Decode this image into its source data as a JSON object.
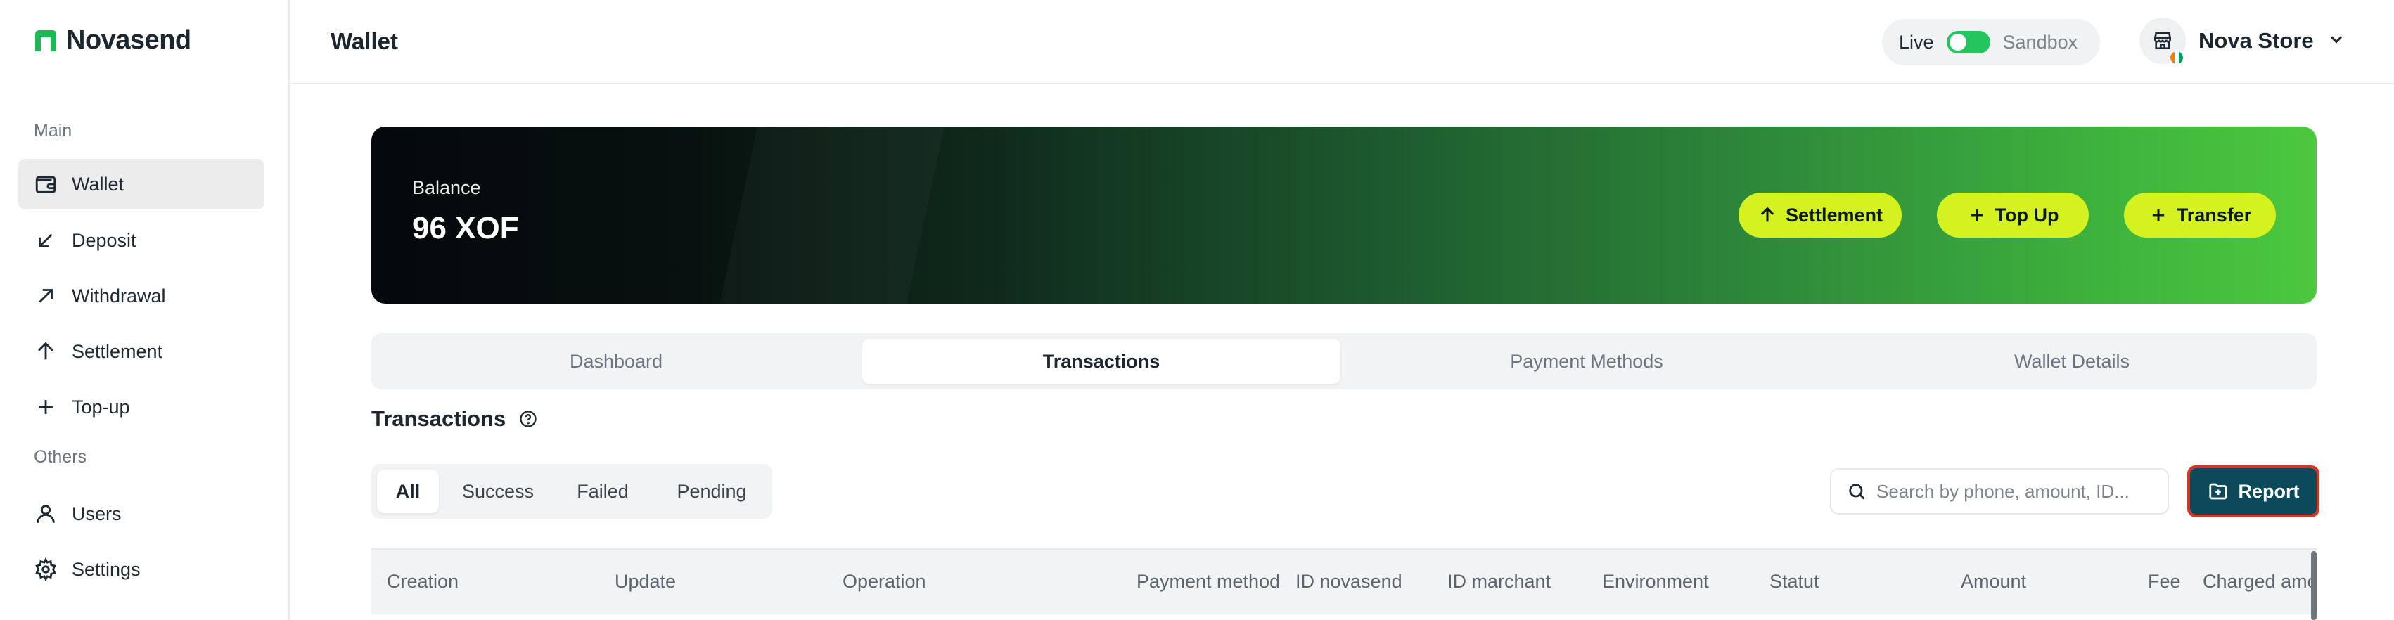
{
  "brand": {
    "name": "Novasend",
    "accent": "#1db954"
  },
  "sidebar": {
    "sections": [
      {
        "label": "Main"
      },
      {
        "label": "Others"
      }
    ],
    "items": [
      {
        "label": "Wallet",
        "icon": "wallet-icon",
        "active": true
      },
      {
        "label": "Deposit",
        "icon": "arrow-down-left-icon"
      },
      {
        "label": "Withdrawal",
        "icon": "arrow-up-right-icon"
      },
      {
        "label": "Settlement",
        "icon": "arrow-up-icon"
      },
      {
        "label": "Top-up",
        "icon": "plus-icon"
      },
      {
        "label": "Users",
        "icon": "user-icon"
      },
      {
        "label": "Settings",
        "icon": "gear-icon"
      }
    ]
  },
  "header": {
    "title": "Wallet",
    "env": {
      "live": "Live",
      "sandbox": "Sandbox",
      "live_enabled": true
    },
    "store": {
      "name": "Nova Store",
      "icon": "store-icon"
    }
  },
  "balance": {
    "label": "Balance",
    "value": "96 XOF",
    "actions": [
      {
        "label": "Settlement",
        "icon": "arrow-up-icon"
      },
      {
        "label": "Top Up",
        "icon": "plus-icon"
      },
      {
        "label": "Transfer",
        "icon": "plus-icon"
      }
    ],
    "button_color": "#d4f21f"
  },
  "tabs": [
    {
      "label": "Dashboard"
    },
    {
      "label": "Transactions",
      "active": true
    },
    {
      "label": "Payment Methods"
    },
    {
      "label": "Wallet Details"
    }
  ],
  "transactions": {
    "title": "Transactions",
    "filters": [
      {
        "label": "All",
        "active": true
      },
      {
        "label": "Success"
      },
      {
        "label": "Failed"
      },
      {
        "label": "Pending"
      }
    ],
    "search_placeholder": "Search by phone, amount, ID...",
    "report_label": "Report",
    "report_color": "#0b4a5a",
    "columns": [
      "Creation",
      "Update",
      "Operation",
      "Payment method",
      "ID novasend",
      "ID marchant",
      "Environment",
      "Statut",
      "Amount",
      "Fee",
      "Charged amo"
    ]
  }
}
